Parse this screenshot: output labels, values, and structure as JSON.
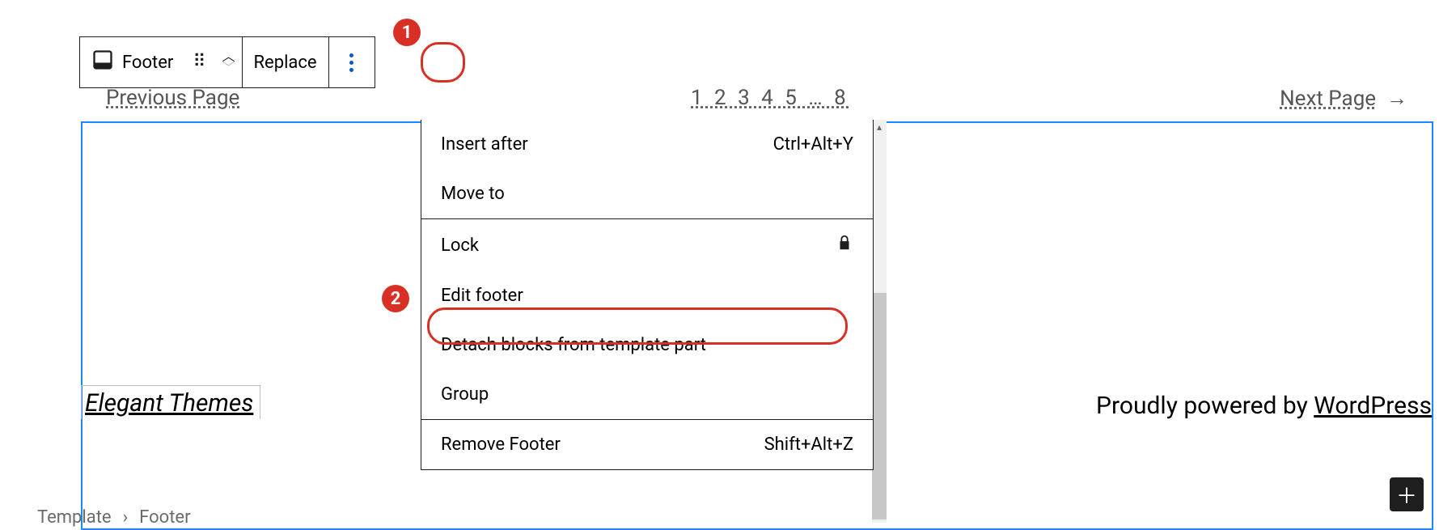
{
  "toolbar": {
    "block_label": "Footer",
    "replace_label": "Replace"
  },
  "annotations": {
    "one": "1",
    "two": "2"
  },
  "pagination": {
    "previous": "Previous Page",
    "numbers": "1 2 3 4 5 … 8",
    "next_label": "Next Page",
    "arrow": "→"
  },
  "footer": {
    "site_title": "Elegant Themes",
    "credit_prefix": "Proudly powered by ",
    "credit_link": "WordPress"
  },
  "menu": {
    "insert_after": {
      "label": "Insert after",
      "shortcut": "Ctrl+Alt+Y"
    },
    "move_to": {
      "label": "Move to"
    },
    "lock": {
      "label": "Lock"
    },
    "edit_footer": {
      "label": "Edit footer"
    },
    "detach": {
      "label": "Detach blocks from template part"
    },
    "group": {
      "label": "Group"
    },
    "remove": {
      "label": "Remove Footer",
      "shortcut": "Shift+Alt+Z"
    }
  },
  "breadcrumb": {
    "root": "Template",
    "sep": "›",
    "leaf": "Footer"
  }
}
